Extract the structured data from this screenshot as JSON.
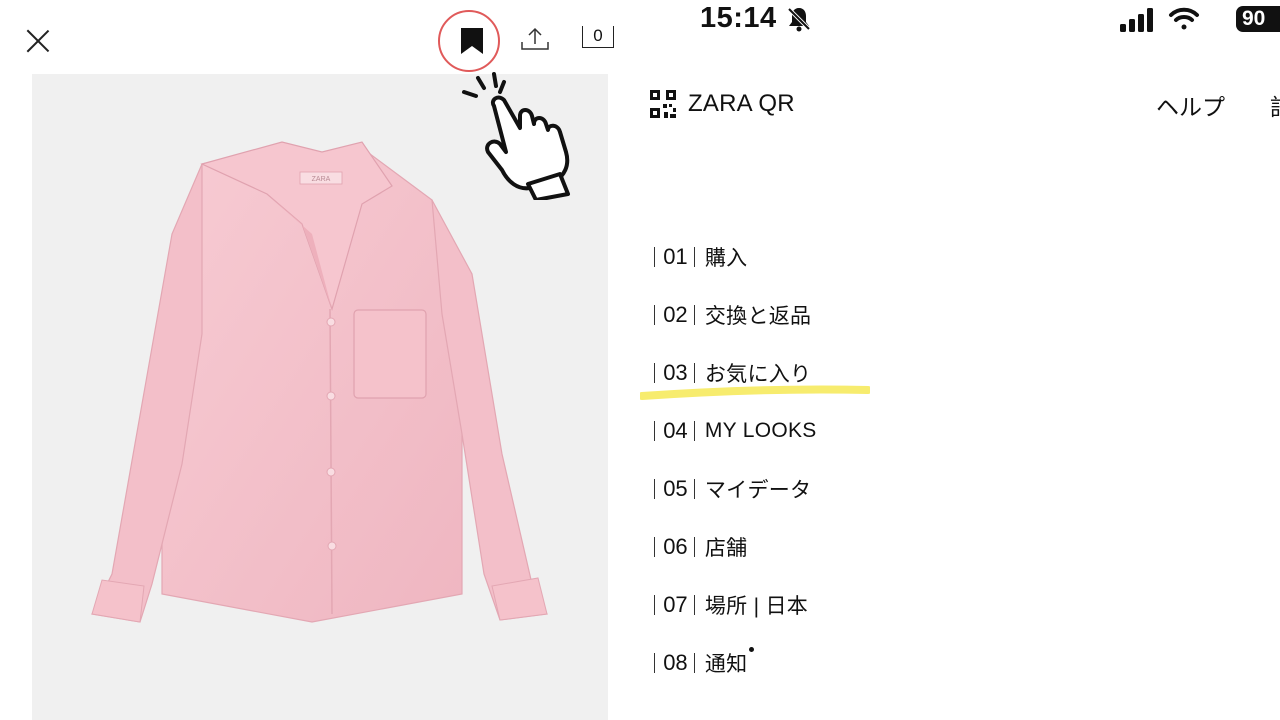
{
  "left_panel": {
    "bag_count": "0",
    "product": {
      "garment_color": "#f4c3cc",
      "tag_text": "ZARA"
    },
    "accent_color": "#e05a5a"
  },
  "status_bar": {
    "time": "15:14",
    "battery": "90"
  },
  "header": {
    "qr_label": "ZARA QR",
    "help_label": "ヘルプ",
    "cut_label": "記"
  },
  "menu": {
    "items": [
      {
        "num": "01",
        "label": "購入"
      },
      {
        "num": "02",
        "label": "交換と返品"
      },
      {
        "num": "03",
        "label": "お気に入り"
      },
      {
        "num": "04",
        "label": "MY LOOKS"
      },
      {
        "num": "05",
        "label": "マイデータ"
      },
      {
        "num": "06",
        "label": "店舗"
      },
      {
        "num": "07",
        "label": "場所 | 日本"
      },
      {
        "num": "08",
        "label": "通知"
      }
    ],
    "highlight_color": "#f7ec6e"
  }
}
